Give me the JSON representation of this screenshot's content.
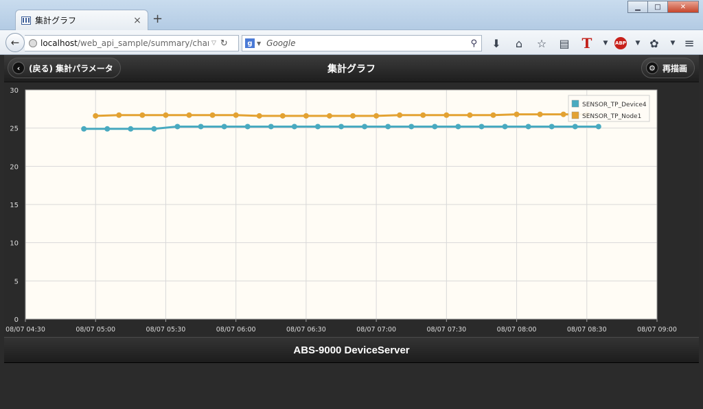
{
  "browser": {
    "tab_title": "集計グラフ",
    "tab_close": "×",
    "new_tab": "+",
    "url_host": "localhost",
    "url_path": "/web_api_sample/summary/chart/in",
    "search_placeholder": "Google",
    "window_minimize": "▁",
    "window_maximize": "□",
    "window_close": "✕"
  },
  "header": {
    "back_label": "(戻る) 集計パラメータ",
    "title": "集計グラフ",
    "redraw_label": "再描画"
  },
  "footer": {
    "title": "ABS-9000 DeviceServer"
  },
  "colors": {
    "series_device4": "#49aac0",
    "series_node1": "#e3a232",
    "plot_bg": "#fffcf5",
    "grid": "#d8d8d8"
  },
  "chart_data": {
    "type": "line",
    "title": "",
    "xlabel": "",
    "ylabel": "",
    "ylim": [
      0,
      30
    ],
    "yticks": [
      "0",
      "5",
      "10",
      "15",
      "20",
      "25",
      "30"
    ],
    "xticks": [
      "08/07 04:30",
      "08/07 05:00",
      "08/07 05:30",
      "08/07 06:00",
      "08/07 06:30",
      "08/07 07:00",
      "08/07 07:30",
      "08/07 08:00",
      "08/07 08:30",
      "08/07 09:00"
    ],
    "xlim": [
      "08/07 04:30",
      "08/07 09:00"
    ],
    "grid": true,
    "legend": "top-right",
    "series": [
      {
        "name": "SENSOR_TP_Device4",
        "color": "#49aac0",
        "x": [
          "08/07 04:55",
          "08/07 05:05",
          "08/07 05:15",
          "08/07 05:25",
          "08/07 05:35",
          "08/07 05:45",
          "08/07 05:55",
          "08/07 06:05",
          "08/07 06:15",
          "08/07 06:25",
          "08/07 06:35",
          "08/07 06:45",
          "08/07 06:55",
          "08/07 07:05",
          "08/07 07:15",
          "08/07 07:25",
          "08/07 07:35",
          "08/07 07:45",
          "08/07 07:55",
          "08/07 08:05",
          "08/07 08:15",
          "08/07 08:25",
          "08/07 08:35"
        ],
        "values": [
          24.9,
          24.9,
          24.9,
          24.9,
          25.2,
          25.2,
          25.2,
          25.2,
          25.2,
          25.2,
          25.2,
          25.2,
          25.2,
          25.2,
          25.2,
          25.2,
          25.2,
          25.2,
          25.2,
          25.2,
          25.2,
          25.2,
          25.2
        ]
      },
      {
        "name": "SENSOR_TP_Node1",
        "color": "#e3a232",
        "x": [
          "08/07 05:00",
          "08/07 05:10",
          "08/07 05:20",
          "08/07 05:30",
          "08/07 05:40",
          "08/07 05:50",
          "08/07 06:00",
          "08/07 06:10",
          "08/07 06:20",
          "08/07 06:30",
          "08/07 06:40",
          "08/07 06:50",
          "08/07 07:00",
          "08/07 07:10",
          "08/07 07:20",
          "08/07 07:30",
          "08/07 07:40",
          "08/07 07:50",
          "08/07 08:00",
          "08/07 08:10",
          "08/07 08:20",
          "08/07 08:30"
        ],
        "values": [
          26.6,
          26.7,
          26.7,
          26.7,
          26.7,
          26.7,
          26.7,
          26.6,
          26.6,
          26.6,
          26.6,
          26.6,
          26.6,
          26.7,
          26.7,
          26.7,
          26.7,
          26.7,
          26.8,
          26.8,
          26.8,
          26.8
        ]
      }
    ]
  }
}
